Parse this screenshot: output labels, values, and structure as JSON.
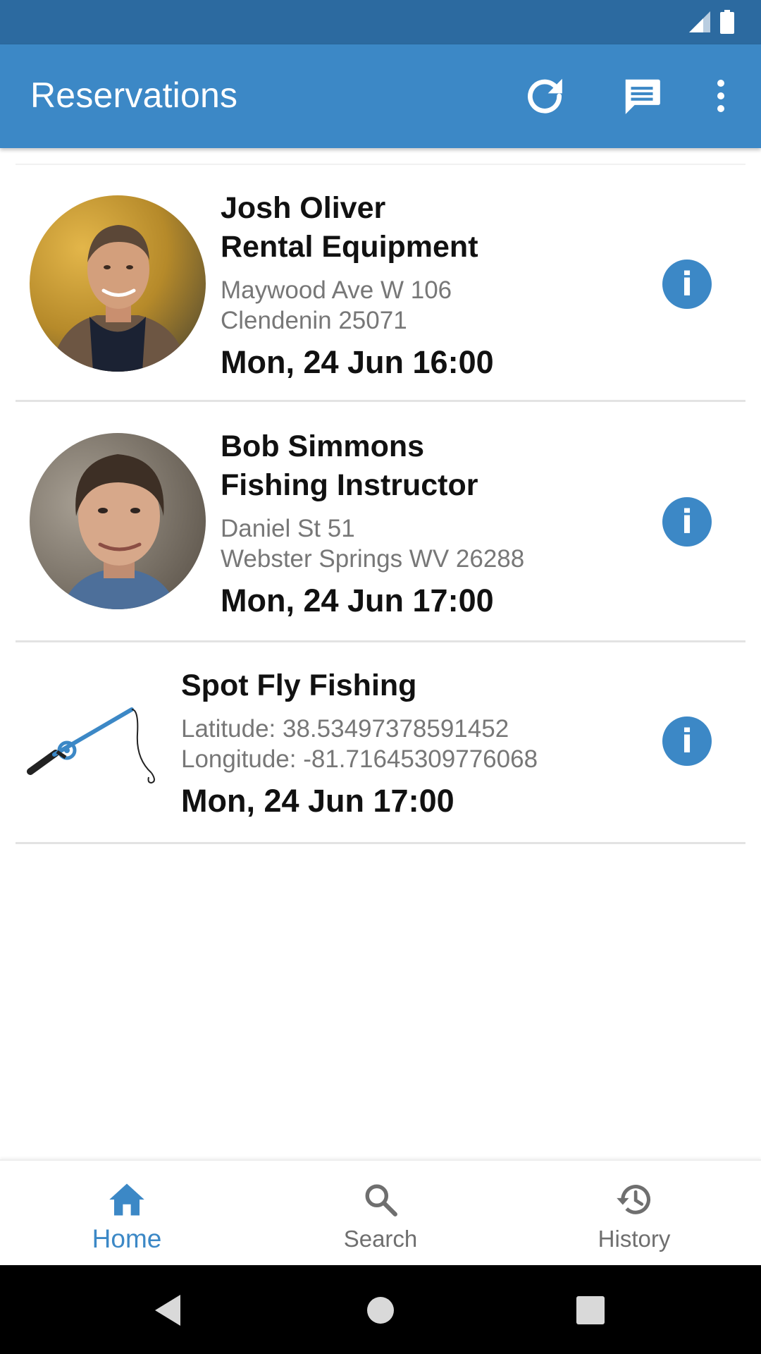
{
  "status_bar": {
    "icons": [
      "signal-icon",
      "battery-icon"
    ]
  },
  "app_bar": {
    "title": "Reservations",
    "actions": [
      "refresh-icon",
      "message-icon",
      "overflow-menu-icon"
    ],
    "color": "#3c88c6"
  },
  "reservations": [
    {
      "name": "Josh Oliver",
      "role": "Rental Equipment",
      "address_line1": "Maywood Ave W 106",
      "address_line2": "Clendenin 25071",
      "datetime": "Mon, 24 Jun 16:00",
      "image": "avatar-photo"
    },
    {
      "name": "Bob Simmons",
      "role": "Fishing Instructor",
      "address_line1": "Daniel St 51",
      "address_line2": "Webster Springs WV 26288",
      "datetime": "Mon, 24 Jun 17:00",
      "image": "avatar-photo"
    },
    {
      "name": "Spot Fly Fishing",
      "latitude": "Latitude: 38.53497378591452",
      "longitude": "Longitude: -81.71645309776068",
      "datetime": "Mon, 24 Jun 17:00",
      "image": "fishing-rod-icon"
    }
  ],
  "info_icon": "info-icon",
  "bottom_nav": {
    "items": [
      {
        "label": "Home",
        "icon": "home-icon",
        "active": true
      },
      {
        "label": "Search",
        "icon": "search-icon",
        "active": false
      },
      {
        "label": "History",
        "icon": "history-icon",
        "active": false
      }
    ]
  },
  "system_nav": [
    "back-icon",
    "home-circle-icon",
    "recents-icon"
  ]
}
